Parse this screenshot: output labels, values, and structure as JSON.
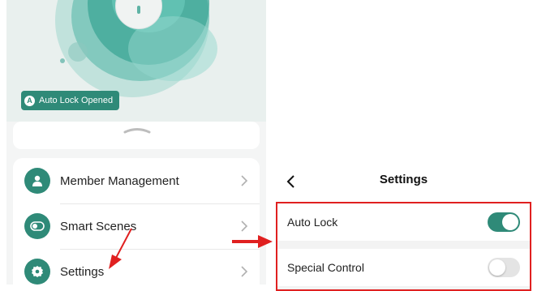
{
  "left": {
    "badge": {
      "icon_letter": "A",
      "label": "Auto Lock Opened"
    },
    "menu": {
      "items": [
        {
          "label": "Member Management",
          "icon": "person-icon"
        },
        {
          "label": "Smart Scenes",
          "icon": "toggle-switch-icon"
        },
        {
          "label": "Settings",
          "icon": "gear-icon"
        }
      ]
    }
  },
  "right": {
    "header": {
      "title": "Settings",
      "back_icon": "chevron-left-icon"
    },
    "settings": [
      {
        "label": "Auto Lock",
        "enabled": true
      },
      {
        "label": "Special Control",
        "enabled": false
      }
    ]
  },
  "colors": {
    "accent": "#2f8a78",
    "annotation_red": "#e02020"
  }
}
